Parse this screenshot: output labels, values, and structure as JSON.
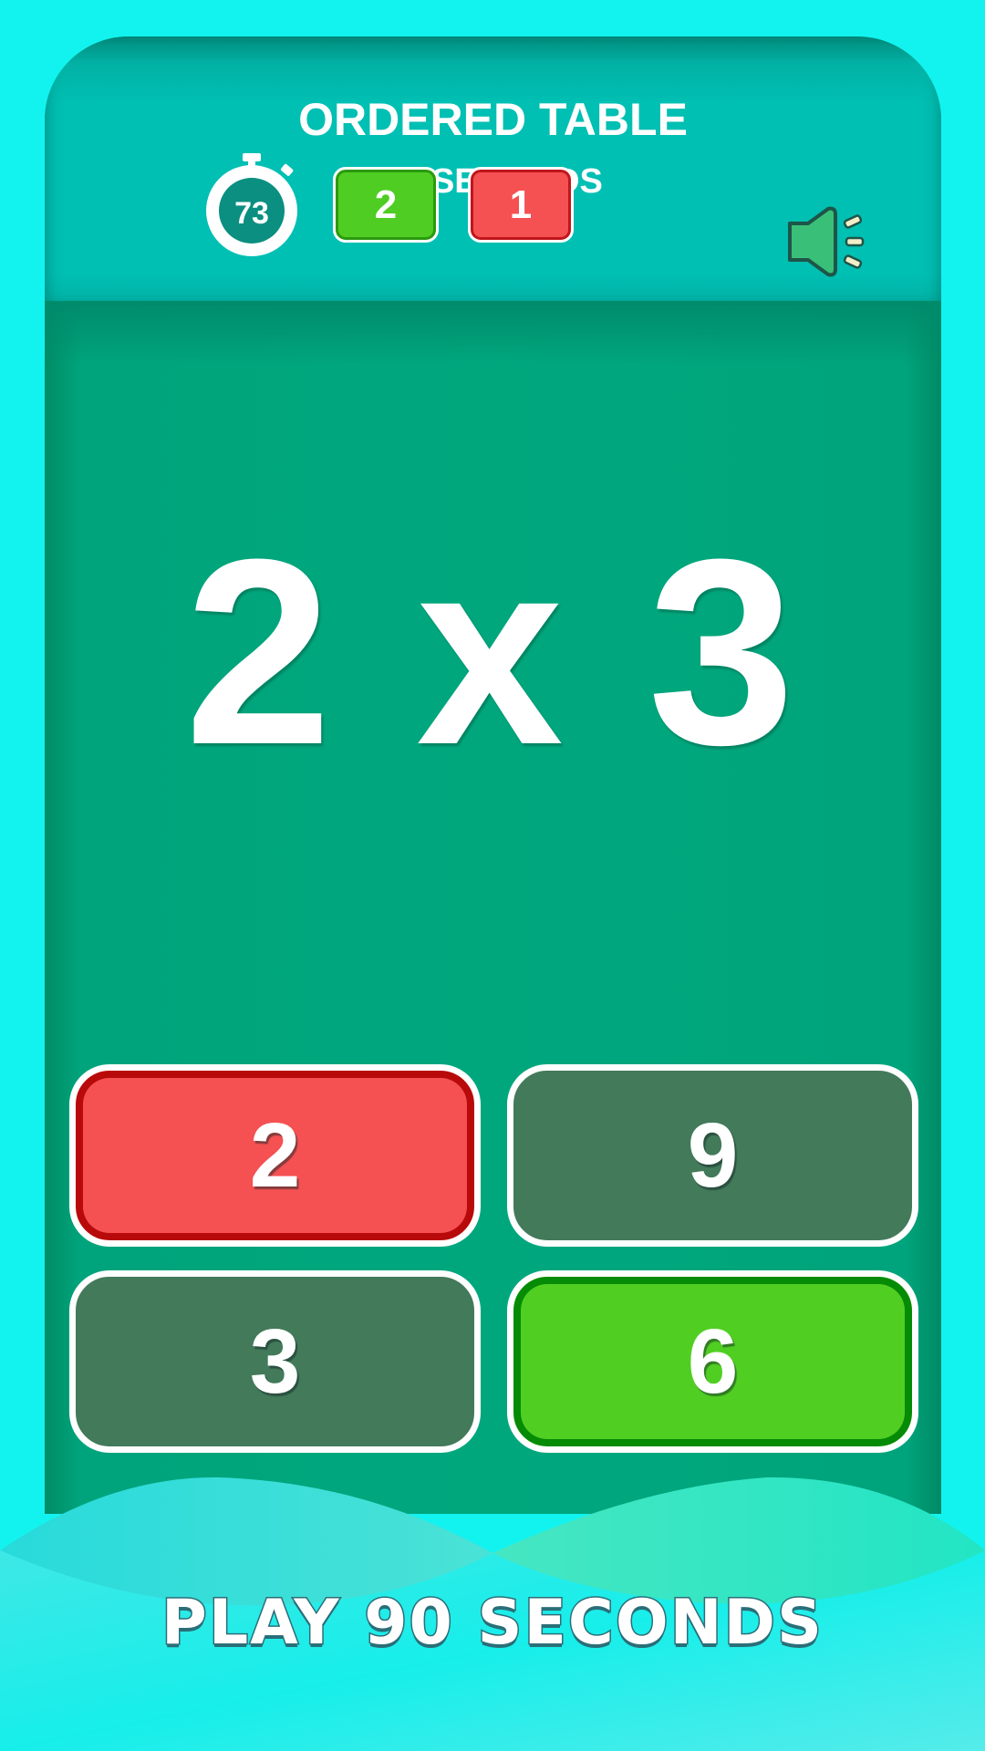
{
  "header": {
    "title": "ORDERED TABLE",
    "subtitle": "90 SECONDS"
  },
  "status": {
    "timer_icon": "stopwatch-icon",
    "timer_value": "73",
    "correct_count": "2",
    "wrong_count": "1",
    "sound_icon": "speaker-on-icon"
  },
  "question": {
    "text": "2 x 3"
  },
  "answers": [
    {
      "label": "2",
      "state": "wrong"
    },
    {
      "label": "9",
      "state": "neutral"
    },
    {
      "label": "3",
      "state": "neutral"
    },
    {
      "label": "6",
      "state": "correct"
    }
  ],
  "footer": {
    "label": "PLAY 90 SECONDS"
  },
  "colors": {
    "background": "#12f3f0",
    "board": "#00a77d",
    "header": "#00bfb3",
    "correct": "#50cf22",
    "wrong": "#f55052",
    "neutral": "#427a5a"
  }
}
